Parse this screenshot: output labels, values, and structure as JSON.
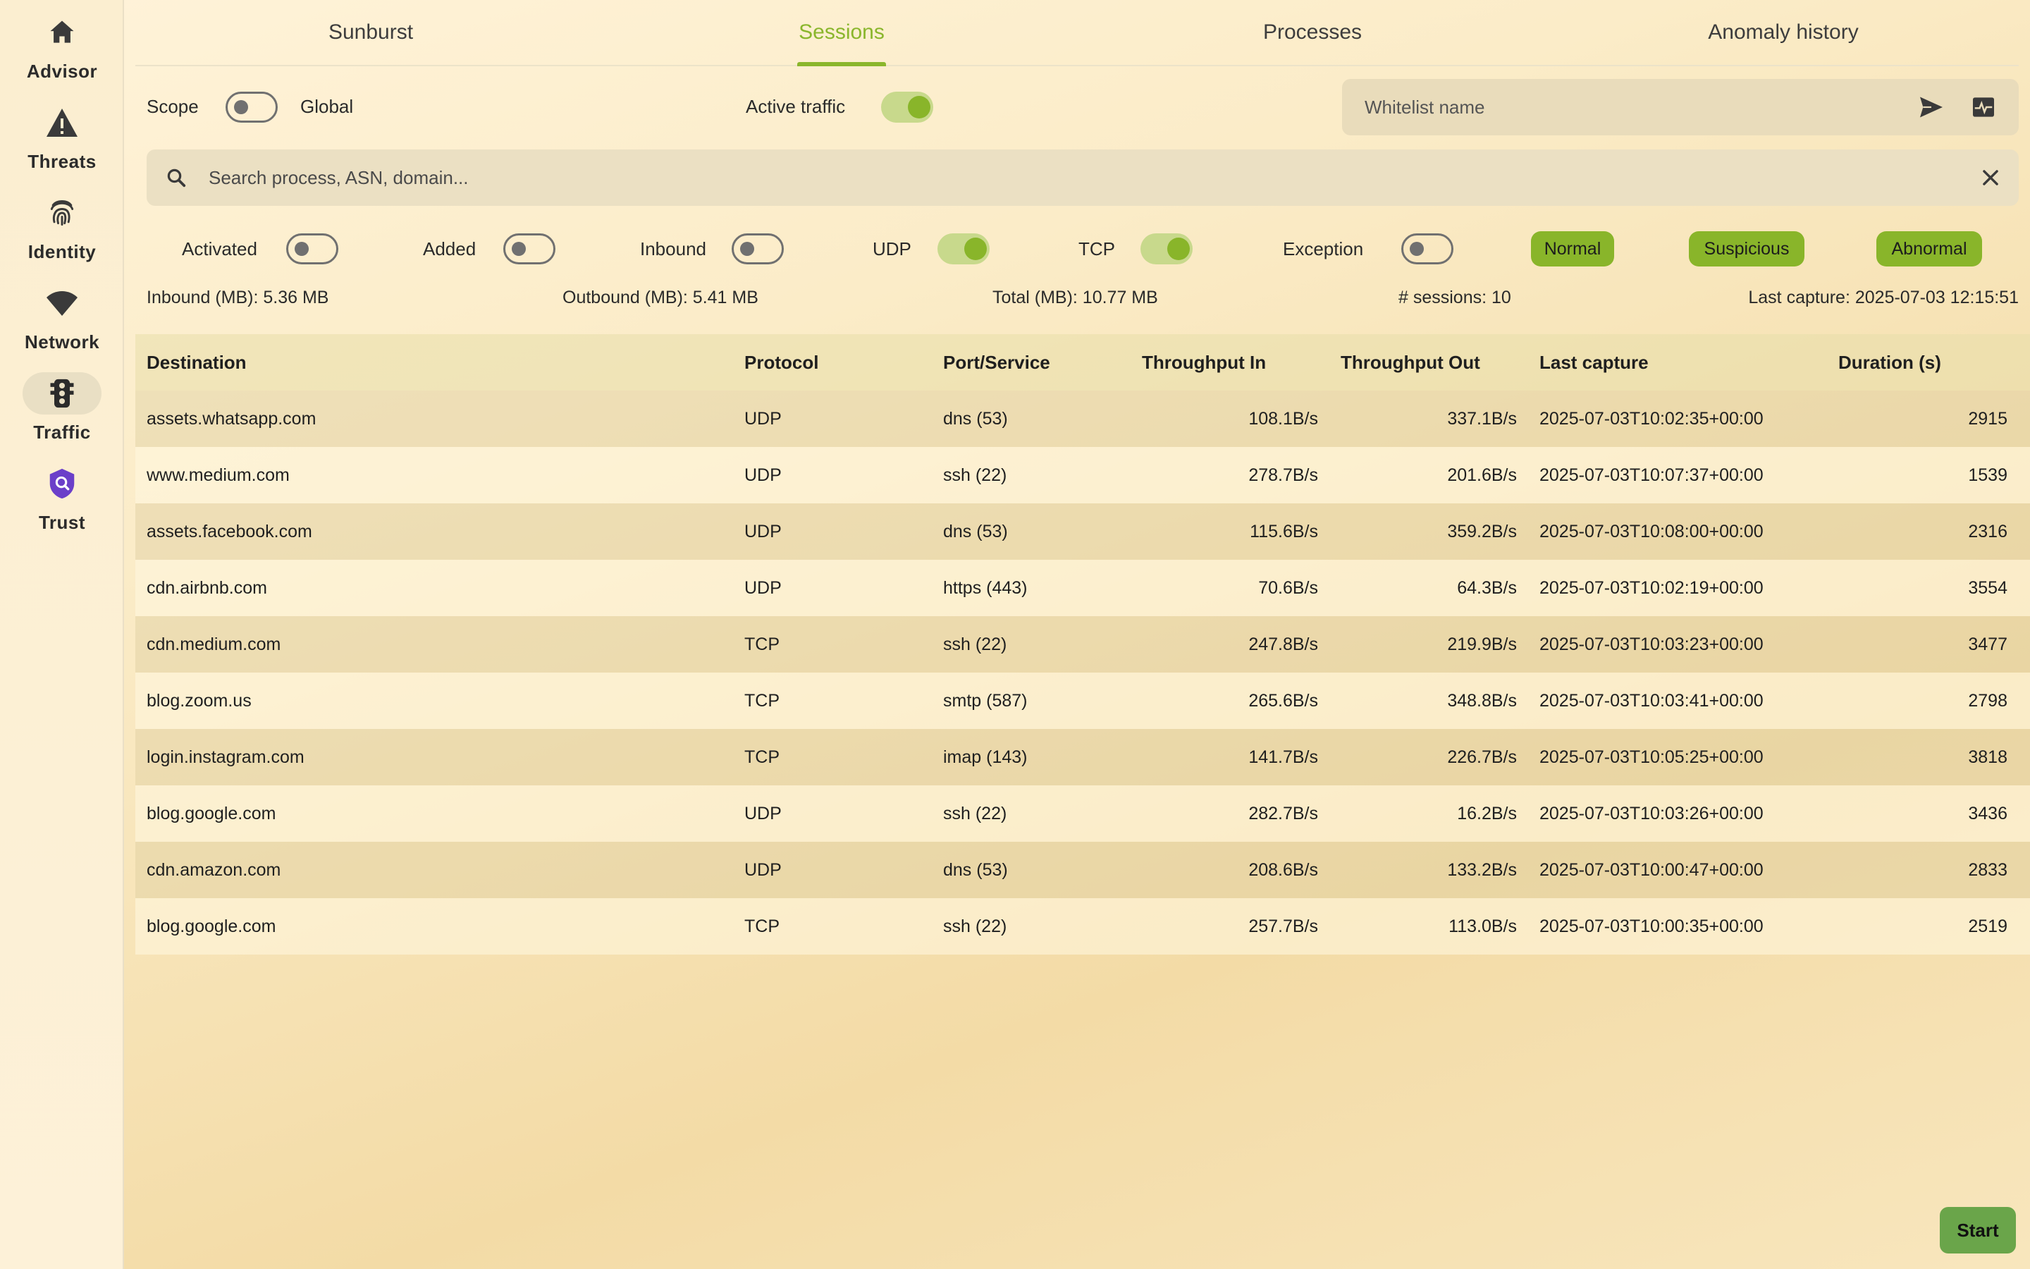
{
  "sidebar": {
    "items": [
      {
        "label": "Advisor",
        "icon": "home-icon"
      },
      {
        "label": "Threats",
        "icon": "warning-icon"
      },
      {
        "label": "Identity",
        "icon": "fingerprint-icon"
      },
      {
        "label": "Network",
        "icon": "wifi-icon"
      },
      {
        "label": "Traffic",
        "icon": "traffic-light-icon",
        "active": true
      },
      {
        "label": "Trust",
        "icon": "shield-search-icon"
      }
    ]
  },
  "tabs": [
    {
      "label": "Sunburst"
    },
    {
      "label": "Sessions",
      "active": true
    },
    {
      "label": "Processes"
    },
    {
      "label": "Anomaly history"
    }
  ],
  "controls": {
    "scope_label": "Scope",
    "scope_on": false,
    "global_label": "Global",
    "active_traffic_label": "Active traffic",
    "active_traffic_on": true,
    "whitelist_placeholder": "Whitelist name",
    "search_placeholder": "Search process, ASN, domain..."
  },
  "filters": {
    "activated_label": "Activated",
    "activated_on": false,
    "added_label": "Added",
    "added_on": false,
    "inbound_label": "Inbound",
    "inbound_on": false,
    "udp_label": "UDP",
    "udp_on": true,
    "tcp_label": "TCP",
    "tcp_on": true,
    "exception_label": "Exception",
    "exception_on": false,
    "chips": [
      "Normal",
      "Suspicious",
      "Abnormal"
    ]
  },
  "stats": {
    "inbound": "Inbound (MB): 5.36 MB",
    "outbound": "Outbound (MB): 5.41 MB",
    "total": "Total (MB): 10.77 MB",
    "sessions": "# sessions: 10",
    "last_capture": "Last capture: 2025-07-03 12:15:51"
  },
  "table": {
    "headers": [
      "Destination",
      "Protocol",
      "Port/Service",
      "Throughput In",
      "Throughput Out",
      "Last capture",
      "Duration (s)"
    ],
    "rows": [
      [
        "assets.whatsapp.com",
        "UDP",
        "dns (53)",
        "108.1B/s",
        "337.1B/s",
        "2025-07-03T10:02:35+00:00",
        "2915"
      ],
      [
        "www.medium.com",
        "UDP",
        "ssh (22)",
        "278.7B/s",
        "201.6B/s",
        "2025-07-03T10:07:37+00:00",
        "1539"
      ],
      [
        "assets.facebook.com",
        "UDP",
        "dns (53)",
        "115.6B/s",
        "359.2B/s",
        "2025-07-03T10:08:00+00:00",
        "2316"
      ],
      [
        "cdn.airbnb.com",
        "UDP",
        "https (443)",
        "70.6B/s",
        "64.3B/s",
        "2025-07-03T10:02:19+00:00",
        "3554"
      ],
      [
        "cdn.medium.com",
        "TCP",
        "ssh (22)",
        "247.8B/s",
        "219.9B/s",
        "2025-07-03T10:03:23+00:00",
        "3477"
      ],
      [
        "blog.zoom.us",
        "TCP",
        "smtp (587)",
        "265.6B/s",
        "348.8B/s",
        "2025-07-03T10:03:41+00:00",
        "2798"
      ],
      [
        "login.instagram.com",
        "TCP",
        "imap (143)",
        "141.7B/s",
        "226.7B/s",
        "2025-07-03T10:05:25+00:00",
        "3818"
      ],
      [
        "blog.google.com",
        "UDP",
        "ssh (22)",
        "282.7B/s",
        "16.2B/s",
        "2025-07-03T10:03:26+00:00",
        "3436"
      ],
      [
        "cdn.amazon.com",
        "UDP",
        "dns (53)",
        "208.6B/s",
        "133.2B/s",
        "2025-07-03T10:00:47+00:00",
        "2833"
      ],
      [
        "blog.google.com",
        "TCP",
        "ssh (22)",
        "257.7B/s",
        "113.0B/s",
        "2025-07-03T10:00:35+00:00",
        "2519"
      ]
    ]
  },
  "start_button": {
    "label": "Start"
  },
  "colors": {
    "accent": "#89b52a",
    "start": "#6aa54a"
  }
}
